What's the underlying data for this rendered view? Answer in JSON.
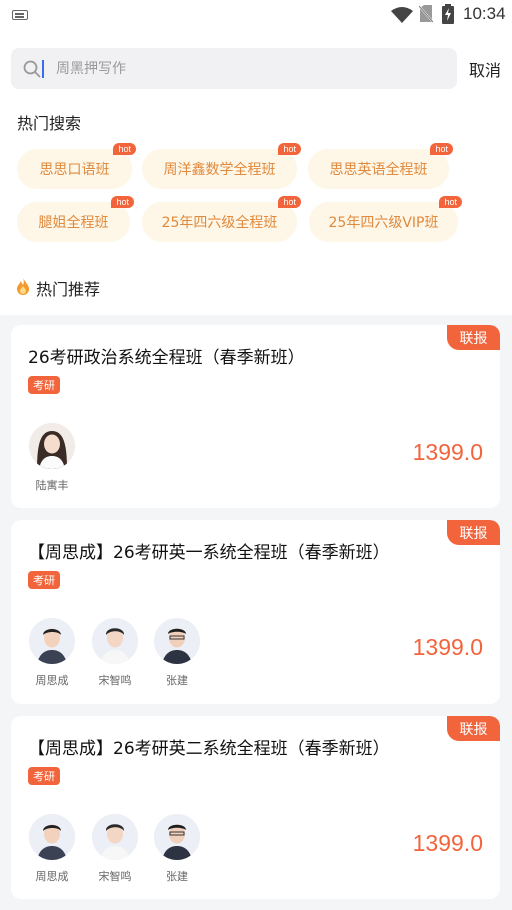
{
  "status_bar": {
    "time": "10:34"
  },
  "search": {
    "placeholder": "周黑押写作",
    "cancel_label": "取消"
  },
  "hot_search": {
    "title": "热门搜索",
    "badge": "hot",
    "chips": [
      "思思口语班",
      "周洋鑫数学全程班",
      "思思英语全程班",
      "腿姐全程班",
      "25年四六级全程班",
      "25年四六级VIP班"
    ]
  },
  "recommend": {
    "title": "热门推荐"
  },
  "courses": [
    {
      "title": "26考研政治系统全程班（春季新班）",
      "tag": "考研",
      "price": "1399.0",
      "badge": "联报",
      "teachers": [
        "陆寓丰"
      ]
    },
    {
      "title": "【周思成】26考研英一系统全程班（春季新班）",
      "tag": "考研",
      "price": "1399.0",
      "badge": "联报",
      "teachers": [
        "周思成",
        "宋智鸣",
        "张建"
      ]
    },
    {
      "title": "【周思成】26考研英二系统全程班（春季新班）",
      "tag": "考研",
      "price": "1399.0",
      "badge": "联报",
      "teachers": [
        "周思成",
        "宋智鸣",
        "张建"
      ]
    }
  ],
  "colors": {
    "accent": "#f2643b",
    "chip_bg": "#fef6e6",
    "chip_text": "#e08a3d"
  }
}
